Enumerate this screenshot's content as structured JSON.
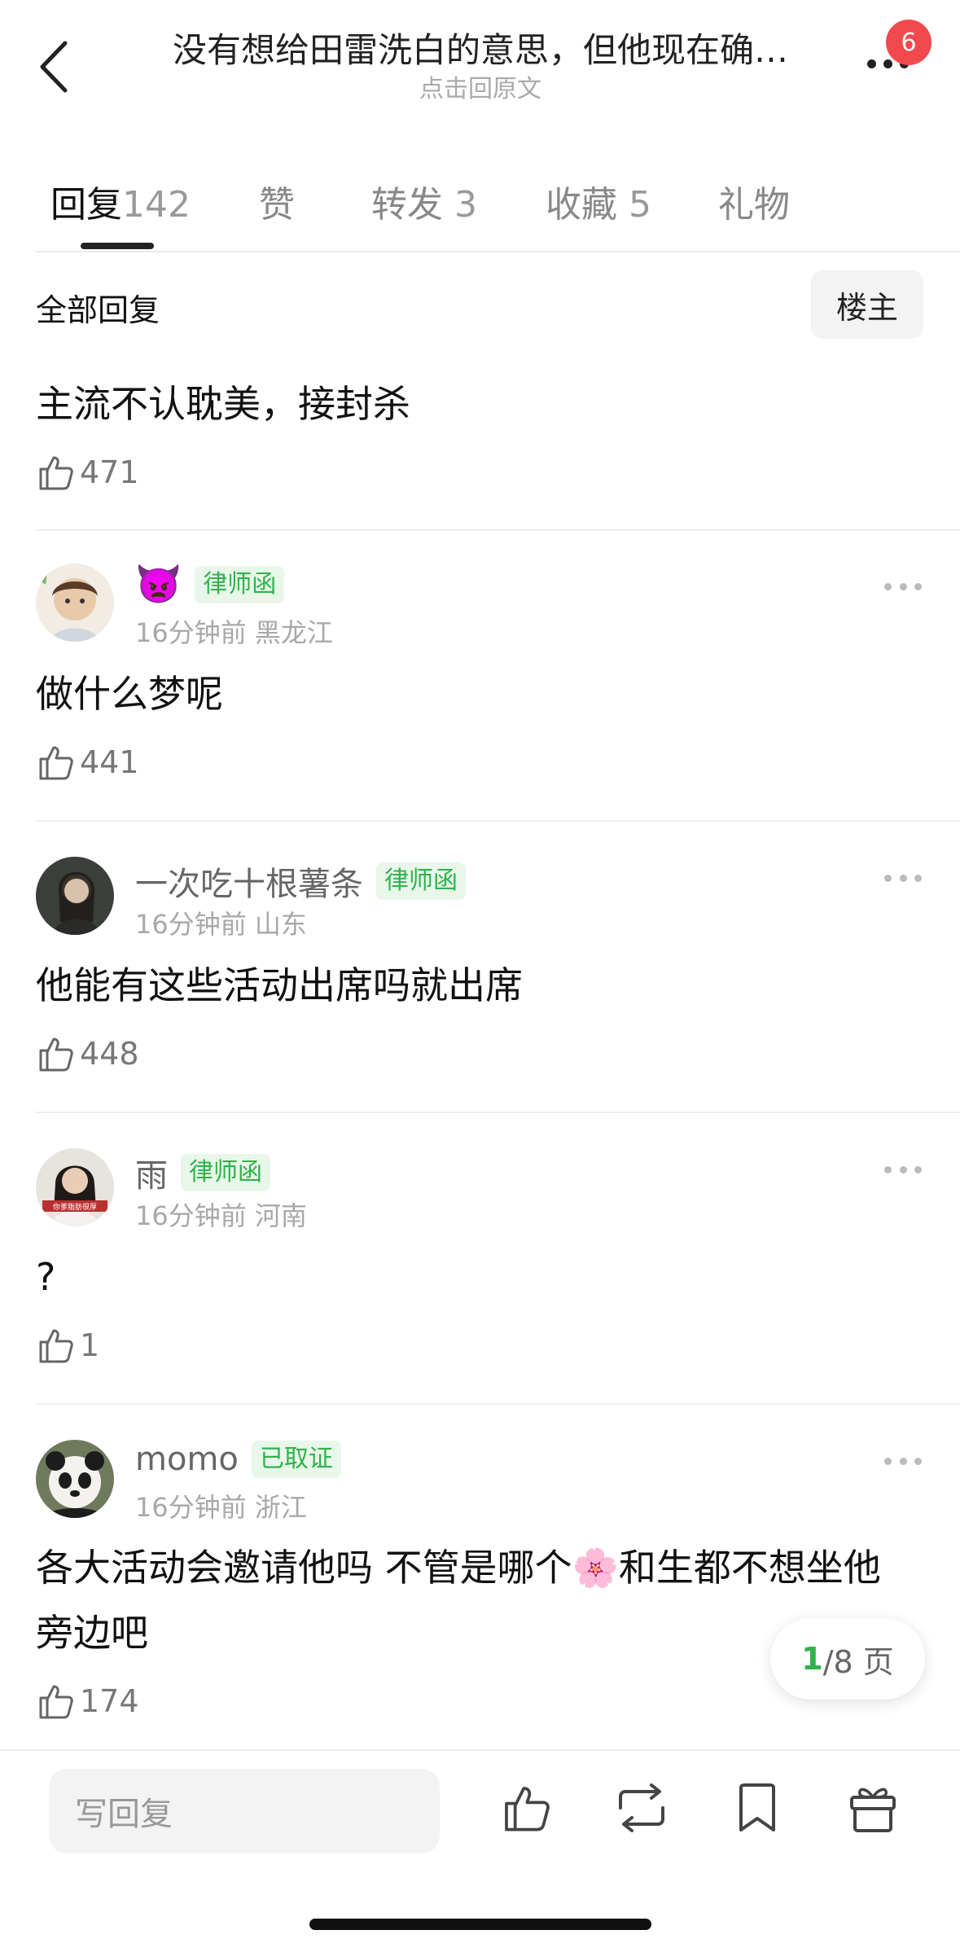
{
  "header": {
    "title": "没有想给田雷洗白的意思，但他现在确…",
    "subtitle": "点击回原文",
    "badge_count": "6"
  },
  "tabs": [
    {
      "label": "回复",
      "count": "142",
      "active": true
    },
    {
      "label": "赞",
      "count": "",
      "active": false
    },
    {
      "label": "转发",
      "count": "3",
      "active": false
    },
    {
      "label": "收藏",
      "count": "5",
      "active": false
    },
    {
      "label": "礼物",
      "count": "",
      "active": false
    }
  ],
  "section": {
    "title": "全部回复",
    "filter_label": "楼主"
  },
  "top_comment": {
    "text": "主流不认耽美，接封杀",
    "likes": "471"
  },
  "comments": [
    {
      "username": "👿",
      "tag": "律师函",
      "time": "16分钟前",
      "location": "黑龙江",
      "text": "做什么梦呢",
      "likes": "441"
    },
    {
      "username": "一次吃十根薯条",
      "tag": "律师函",
      "time": "16分钟前",
      "location": "山东",
      "text": "他能有这些活动出席吗就出席",
      "likes": "448"
    },
    {
      "username": "雨",
      "tag": "律师函",
      "time": "16分钟前",
      "location": "河南",
      "text": "?",
      "likes": "1"
    },
    {
      "username": "momo",
      "tag": "已取证",
      "time": "16分钟前",
      "location": "浙江",
      "text_line1": "各大活动会邀请他吗 不管是哪个",
      "emoji": "🌸",
      "text_line1_tail": "和生都不想坐他",
      "text_line2": "旁边吧",
      "likes": "174"
    }
  ],
  "pager": {
    "current": "1",
    "total_text": "/8 页"
  },
  "bottom_bar": {
    "reply_placeholder": "写回复"
  },
  "colors": {
    "accent_green": "#2fb34a",
    "badge_red": "#f2494c"
  }
}
